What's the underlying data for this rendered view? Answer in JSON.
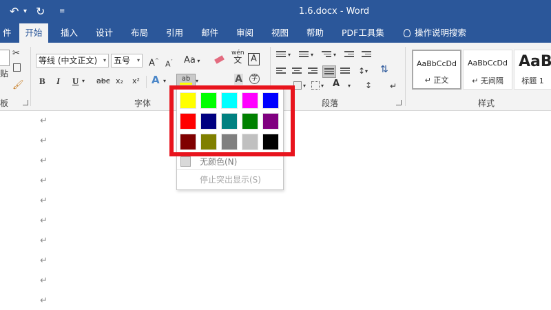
{
  "title_bar": {
    "document_title": "1.6.docx  -  Word",
    "bg_color": "#2b579a"
  },
  "quick_access": {
    "undo_icon": "undo-icon",
    "redo_icon": "redo-icon",
    "customize_icon": "customize-quick-access-icon"
  },
  "tabs": [
    {
      "label": "件",
      "active": false
    },
    {
      "label": "开始",
      "active": true
    },
    {
      "label": "插入",
      "active": false
    },
    {
      "label": "设计",
      "active": false
    },
    {
      "label": "布局",
      "active": false
    },
    {
      "label": "引用",
      "active": false
    },
    {
      "label": "邮件",
      "active": false
    },
    {
      "label": "审阅",
      "active": false
    },
    {
      "label": "视图",
      "active": false
    },
    {
      "label": "帮助",
      "active": false
    },
    {
      "label": "PDF工具集",
      "active": false
    },
    {
      "label": "操作说明搜索",
      "active": false
    }
  ],
  "ribbon": {
    "groups": {
      "clipboard": "板",
      "font": "字体",
      "paragraph": "段落",
      "styles": "样式"
    },
    "paste_partial": "贴",
    "font_name": "等线 (中文正文)",
    "font_size": "五号",
    "grow_font": "A",
    "shrink_font": "A",
    "change_case": "Aa",
    "phonetic_top": "wén",
    "phonetic_bottom": "文",
    "char_border": "A",
    "bold": "B",
    "italic": "I",
    "underline": "U",
    "strikethrough": "abc",
    "subscript": "x₂",
    "superscript": "x²",
    "text_effect": "A",
    "highlight": "ab",
    "font_color": "A",
    "char_shading": "A",
    "enclose": "字",
    "styles": [
      {
        "sample": "AaBbCcDd",
        "name": "↵ 正文",
        "selected": true
      },
      {
        "sample": "AaBbCcDd",
        "name": "↵ 无间隔",
        "selected": false
      },
      {
        "sample": "AaB",
        "name": "标题 1",
        "selected": false
      }
    ]
  },
  "document": {
    "paragraph_mark": "↵"
  },
  "highlight_menu": {
    "colors": [
      "#ffff00",
      "#00ff00",
      "#00ffff",
      "#ff00ff",
      "#0000ff",
      "#ff0000",
      "#000080",
      "#008080",
      "#008000",
      "#800080",
      "#800000",
      "#808000",
      "#808080",
      "#c0c0c0",
      "#000000"
    ],
    "no_color_label": "无颜色(N)",
    "stop_highlight_label": "停止突出显示(S)",
    "annotation_color": "#e8141d"
  }
}
